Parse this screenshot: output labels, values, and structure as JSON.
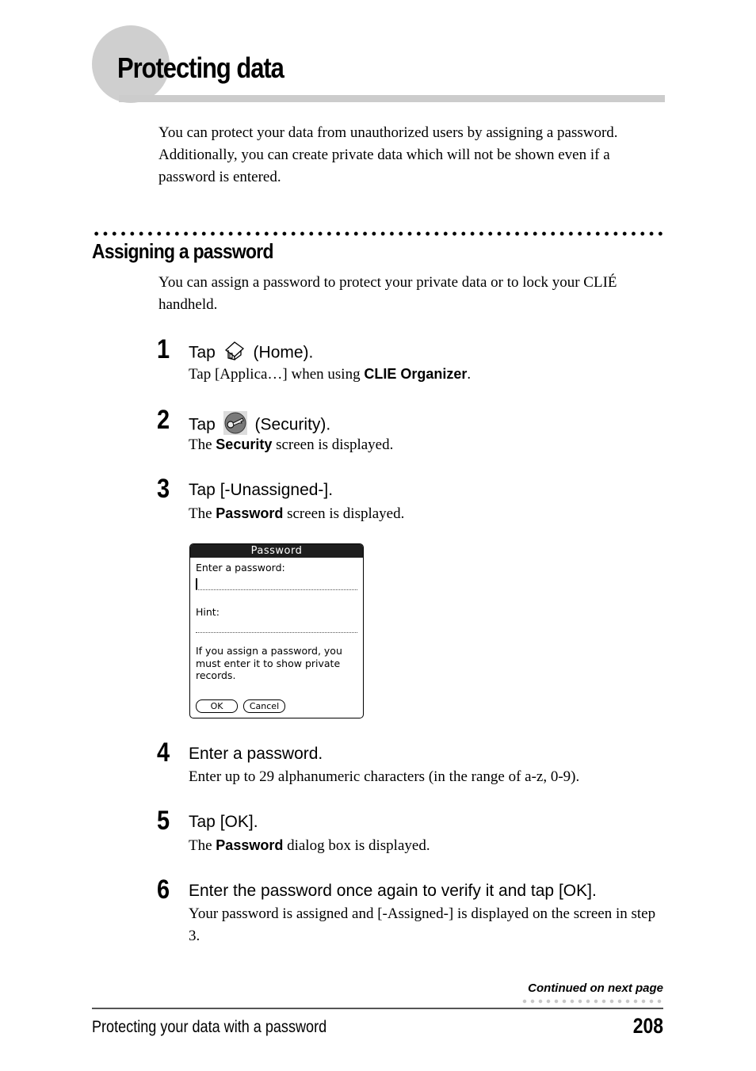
{
  "page": {
    "title": "Protecting data",
    "intro": "You can protect your data from unauthorized users by assigning a password. Additionally, you can create private data which will not be shown even if a password is entered."
  },
  "section": {
    "title": "Assigning a password",
    "intro": "You can assign a password to protect your private data or to lock your CLIÉ handheld."
  },
  "steps": [
    {
      "number": "1",
      "head_before": "Tap",
      "icon": "home-icon",
      "head_after": "(Home).",
      "desc_before": "Tap [Applica…] when using ",
      "desc_bold": "CLIE Organizer",
      "desc_after": "."
    },
    {
      "number": "2",
      "head_before": "Tap",
      "icon": "security-key-icon",
      "head_after": "(Security).",
      "desc_before": "The ",
      "desc_bold": "Security",
      "desc_after": " screen is displayed."
    },
    {
      "number": "3",
      "head": "Tap [-Unassigned-].",
      "desc_before": "The ",
      "desc_bold": "Password",
      "desc_after": " screen is displayed."
    },
    {
      "number": "4",
      "head": "Enter a password.",
      "desc": "Enter up to 29 alphanumeric characters (in the range of a-z, 0-9)."
    },
    {
      "number": "5",
      "head": "Tap [OK].",
      "desc_before": "The ",
      "desc_bold": "Password",
      "desc_after": " dialog box is displayed."
    },
    {
      "number": "6",
      "head": "Enter the password once again to verify it and tap [OK].",
      "desc": "Your password is assigned and [-Assigned-]  is displayed on the screen in step 3."
    }
  ],
  "palm_screen": {
    "title": "Password",
    "password_label": "Enter a password:",
    "password_value": "",
    "hint_label": "Hint:",
    "hint_value": "",
    "note": "If you assign a password, you must enter it to show private records.",
    "ok_label": "OK",
    "cancel_label": "Cancel"
  },
  "footer": {
    "continued": "Continued on next page",
    "section_name": "Protecting your data with a password",
    "page_number": "208"
  }
}
